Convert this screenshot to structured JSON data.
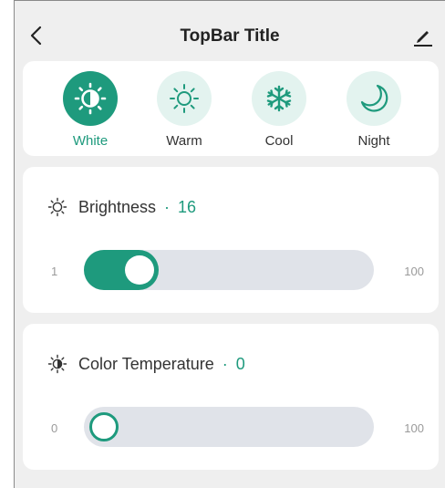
{
  "topbar": {
    "title": "TopBar Title",
    "back_icon": "chevron-left-icon",
    "edit_icon": "pencil-icon"
  },
  "colors": {
    "accent": "#1e9a7d",
    "accent_light": "#e3f3ef",
    "track": "#e0e3e9",
    "background": "#efefef"
  },
  "modes": [
    {
      "label": "White",
      "icon": "white-light-icon",
      "active": true
    },
    {
      "label": "Warm",
      "icon": "sun-icon",
      "active": false
    },
    {
      "label": "Cool",
      "icon": "snowflake-icon",
      "active": false
    },
    {
      "label": "Night",
      "icon": "moon-icon",
      "active": false
    }
  ],
  "brightness": {
    "label": "Brightness",
    "separator": "·",
    "value": "16",
    "min": "1",
    "max": "100",
    "icon": "sun-icon"
  },
  "color_temperature": {
    "label": "Color Temperature",
    "separator": "·",
    "value": "0",
    "min": "0",
    "max": "100",
    "icon": "color-temperature-icon"
  }
}
